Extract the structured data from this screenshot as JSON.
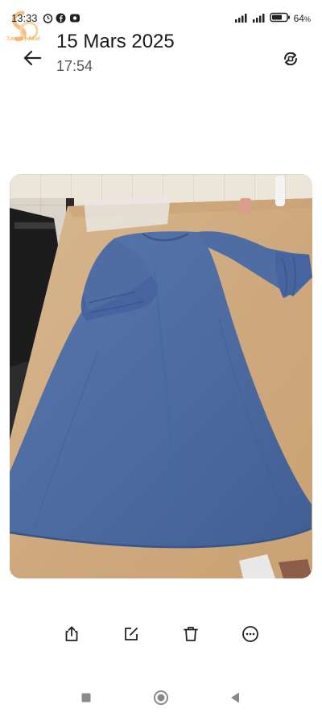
{
  "status_bar": {
    "time": "13:33",
    "battery_percent": "64",
    "battery_suffix": "%",
    "icons": [
      "alarm-icon",
      "facebook-icon",
      "screen-record-icon",
      "signal-icon",
      "signal-icon",
      "battery-icon"
    ]
  },
  "watermark": {
    "text": "Sarpa | Jalal"
  },
  "header": {
    "date": "15 Mars 2025",
    "time": "17:54",
    "back_icon": "arrow-left-icon",
    "rotate_icon": "rotate-icon"
  },
  "photo": {
    "description_icon": "photo-dress",
    "colors": {
      "dress": "#4a6a9f",
      "table": "#d4b28a",
      "wall": "#e8e2d6"
    }
  },
  "toolbar": {
    "items": [
      {
        "icon": "share-icon"
      },
      {
        "icon": "edit-icon"
      },
      {
        "icon": "delete-icon"
      },
      {
        "icon": "more-icon"
      }
    ]
  },
  "navbar": {
    "items": [
      {
        "icon": "recents-square-icon"
      },
      {
        "icon": "home-circle-icon"
      },
      {
        "icon": "back-triangle-icon"
      }
    ]
  }
}
